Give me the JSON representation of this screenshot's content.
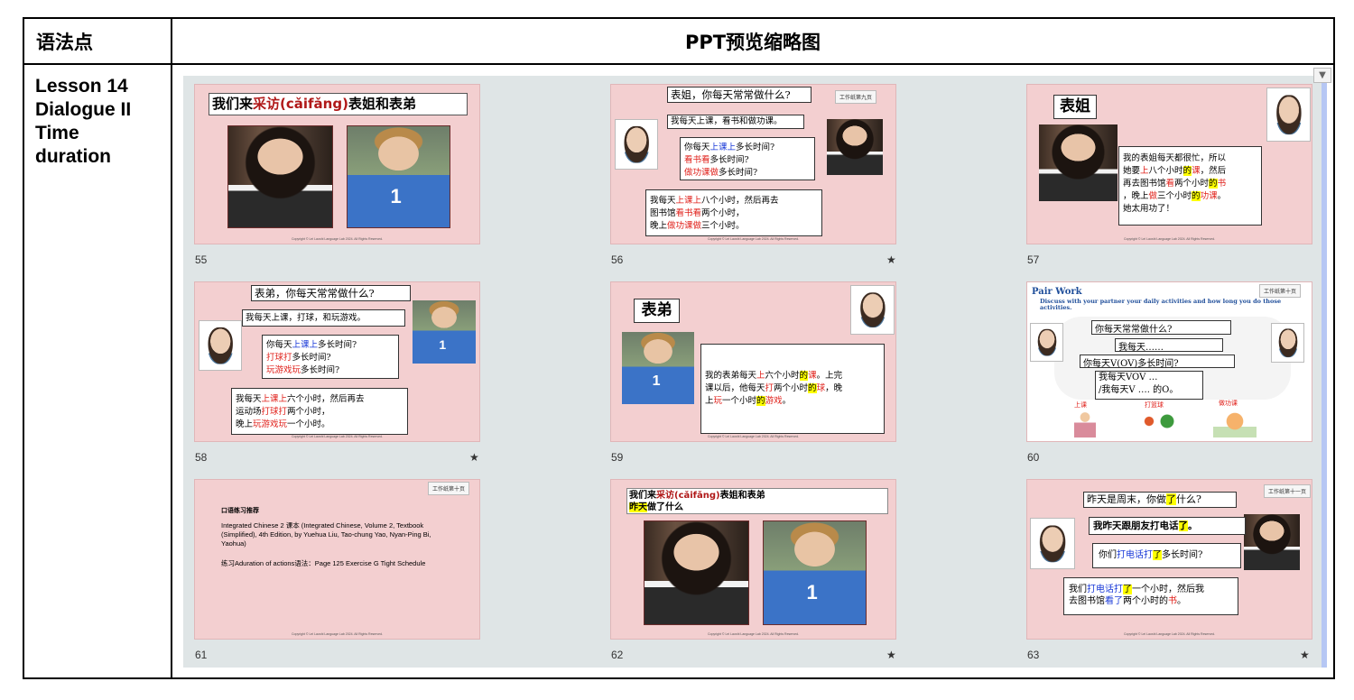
{
  "headers": {
    "col1": "语法点",
    "col2": "PPT预览缩略图"
  },
  "lesson": {
    "line1": "Lesson 14",
    "line2": "Dialogue II",
    "line3": "Time",
    "line4": "duration"
  },
  "copyright": "Copyright © Lei Laoshi Language Lab 2024. All Rights Reserved.",
  "star_icon": "★",
  "slides": [
    {
      "num": "55",
      "title_a": "我们来",
      "title_b": "采访(cǎifǎng)",
      "title_c": "表姐和表弟"
    },
    {
      "num": "56",
      "tag": "工作纸第九页",
      "q": "表姐，你每天常常做什么?",
      "a": "我每天上课，看书和做功课。",
      "q2_1": "你每天",
      "q2_1r": "上课上",
      "q2_1e": "多长时间?",
      "q2_2r": "看书看",
      "q2_2e": "多长时间?",
      "q2_3r": "做功课做",
      "q2_3e": "多长时间?",
      "ans_1a": "我每天",
      "ans_1r": "上课上",
      "ans_1b": "八个小时，然后再去",
      "ans_2a": "图书馆",
      "ans_2r": "看书看",
      "ans_2b": "两个小时，",
      "ans_3a": "晚上",
      "ans_3r": "做功课做",
      "ans_3b": "三个小时。"
    },
    {
      "num": "57",
      "title": "表姐",
      "p1": "我的表姐每天都很忙，所以",
      "p2a": "她要",
      "p2r": "上",
      "p2b": "八个小时",
      "p2h": "的",
      "p2r2": "课",
      "p2c": "，然后",
      "p3a": "再去图书馆",
      "p3r": "看",
      "p3b": "两个小时",
      "p3h": "的",
      "p3r2": "书",
      "p4a": "，晚上",
      "p4r": "做",
      "p4b": "三个小时",
      "p4h": "的",
      "p4r2": "功课",
      "p4c": "。",
      "p5": "她太用功了！"
    },
    {
      "num": "58",
      "q": "表弟，你每天常常做什么?",
      "a": "我每天上课，打球，和玩游戏。",
      "q2_1": "你每天",
      "q2_1r": "上课上",
      "q2_1e": "多长时间?",
      "q2_2r": "打球打",
      "q2_2e": "多长时间?",
      "q2_3r": "玩游戏玩",
      "q2_3e": "多长时间?",
      "ans_1a": "我每天",
      "ans_1r": "上课上",
      "ans_1b": "六个小时，然后再去",
      "ans_2a": "运动场",
      "ans_2r": "打球打",
      "ans_2b": "两个小时，",
      "ans_3a": "晚上",
      "ans_3r": "玩游戏玩",
      "ans_3b": "一个小时。"
    },
    {
      "num": "59",
      "title": "表弟",
      "p1a": "我的表弟每天",
      "p1r": "上",
      "p1b": "六个小时",
      "p1h": "的",
      "p1r2": "课",
      "p1c": "。上完",
      "p2a": "课以后，他每天",
      "p2r": "打",
      "p2b": "两个小时",
      "p2h": "的",
      "p2r2": "球",
      "p2c": "，晚",
      "p3a": "上",
      "p3r": "玩",
      "p3b": "一个小时",
      "p3h": "的",
      "p3r2": "游戏",
      "p3c": "。"
    },
    {
      "num": "60",
      "tag": "工作纸第十页",
      "title": "Pair Work",
      "bullet": "Discuss with your partner your daily activities and how long you do those activities.",
      "l1": "你每天常常做什么?",
      "l2": "我每天……",
      "l3": "你每天V(OV)多长时间?",
      "l4": "我每天VOV …",
      "l5": "/我每天V …. 的O。",
      "c1": "上课",
      "c2": "打篮球",
      "c3": "做功课"
    },
    {
      "num": "61",
      "tag": "工作纸第十页",
      "heading": "口语练习推荐",
      "body": "Integrated Chinese 2 课本 (Integrated Chinese, Volume 2, Textbook (Simplified), 4th Edition, by Yuehua Liu, Tao-chung Yao, Nyan-Ping Bi, Yaohua)",
      "practice": "练习Aduration of actions语法：Page 125 Exercise G Tight Schedule"
    },
    {
      "num": "62",
      "t1a": "我们来",
      "t1b": "采访(cǎifǎng)",
      "t1c": "表姐和表弟",
      "t2a": "昨天",
      "t2b": "做了什么"
    },
    {
      "num": "63",
      "tag": "工作纸第十一页",
      "q1a": "昨天是周末，你做",
      "q1h": "了",
      "q1b": "什么?",
      "a1a": "我昨天跟朋友打电话",
      "a1h": "了",
      "a1b": "。",
      "q2a": "你们",
      "q2r": "打电话",
      "q2b": "打",
      "q2h": "了",
      "q2c": "多长时间?",
      "a2a": "我们",
      "a2r": "打电话",
      "a2b": "打",
      "a2h": "了",
      "a2c": "一个小时，然后我",
      "a2d": "去图书馆",
      "a2r2": "看了",
      "a2e": "两个小时的",
      "a2r3": "书",
      "a2f": "。"
    }
  ]
}
